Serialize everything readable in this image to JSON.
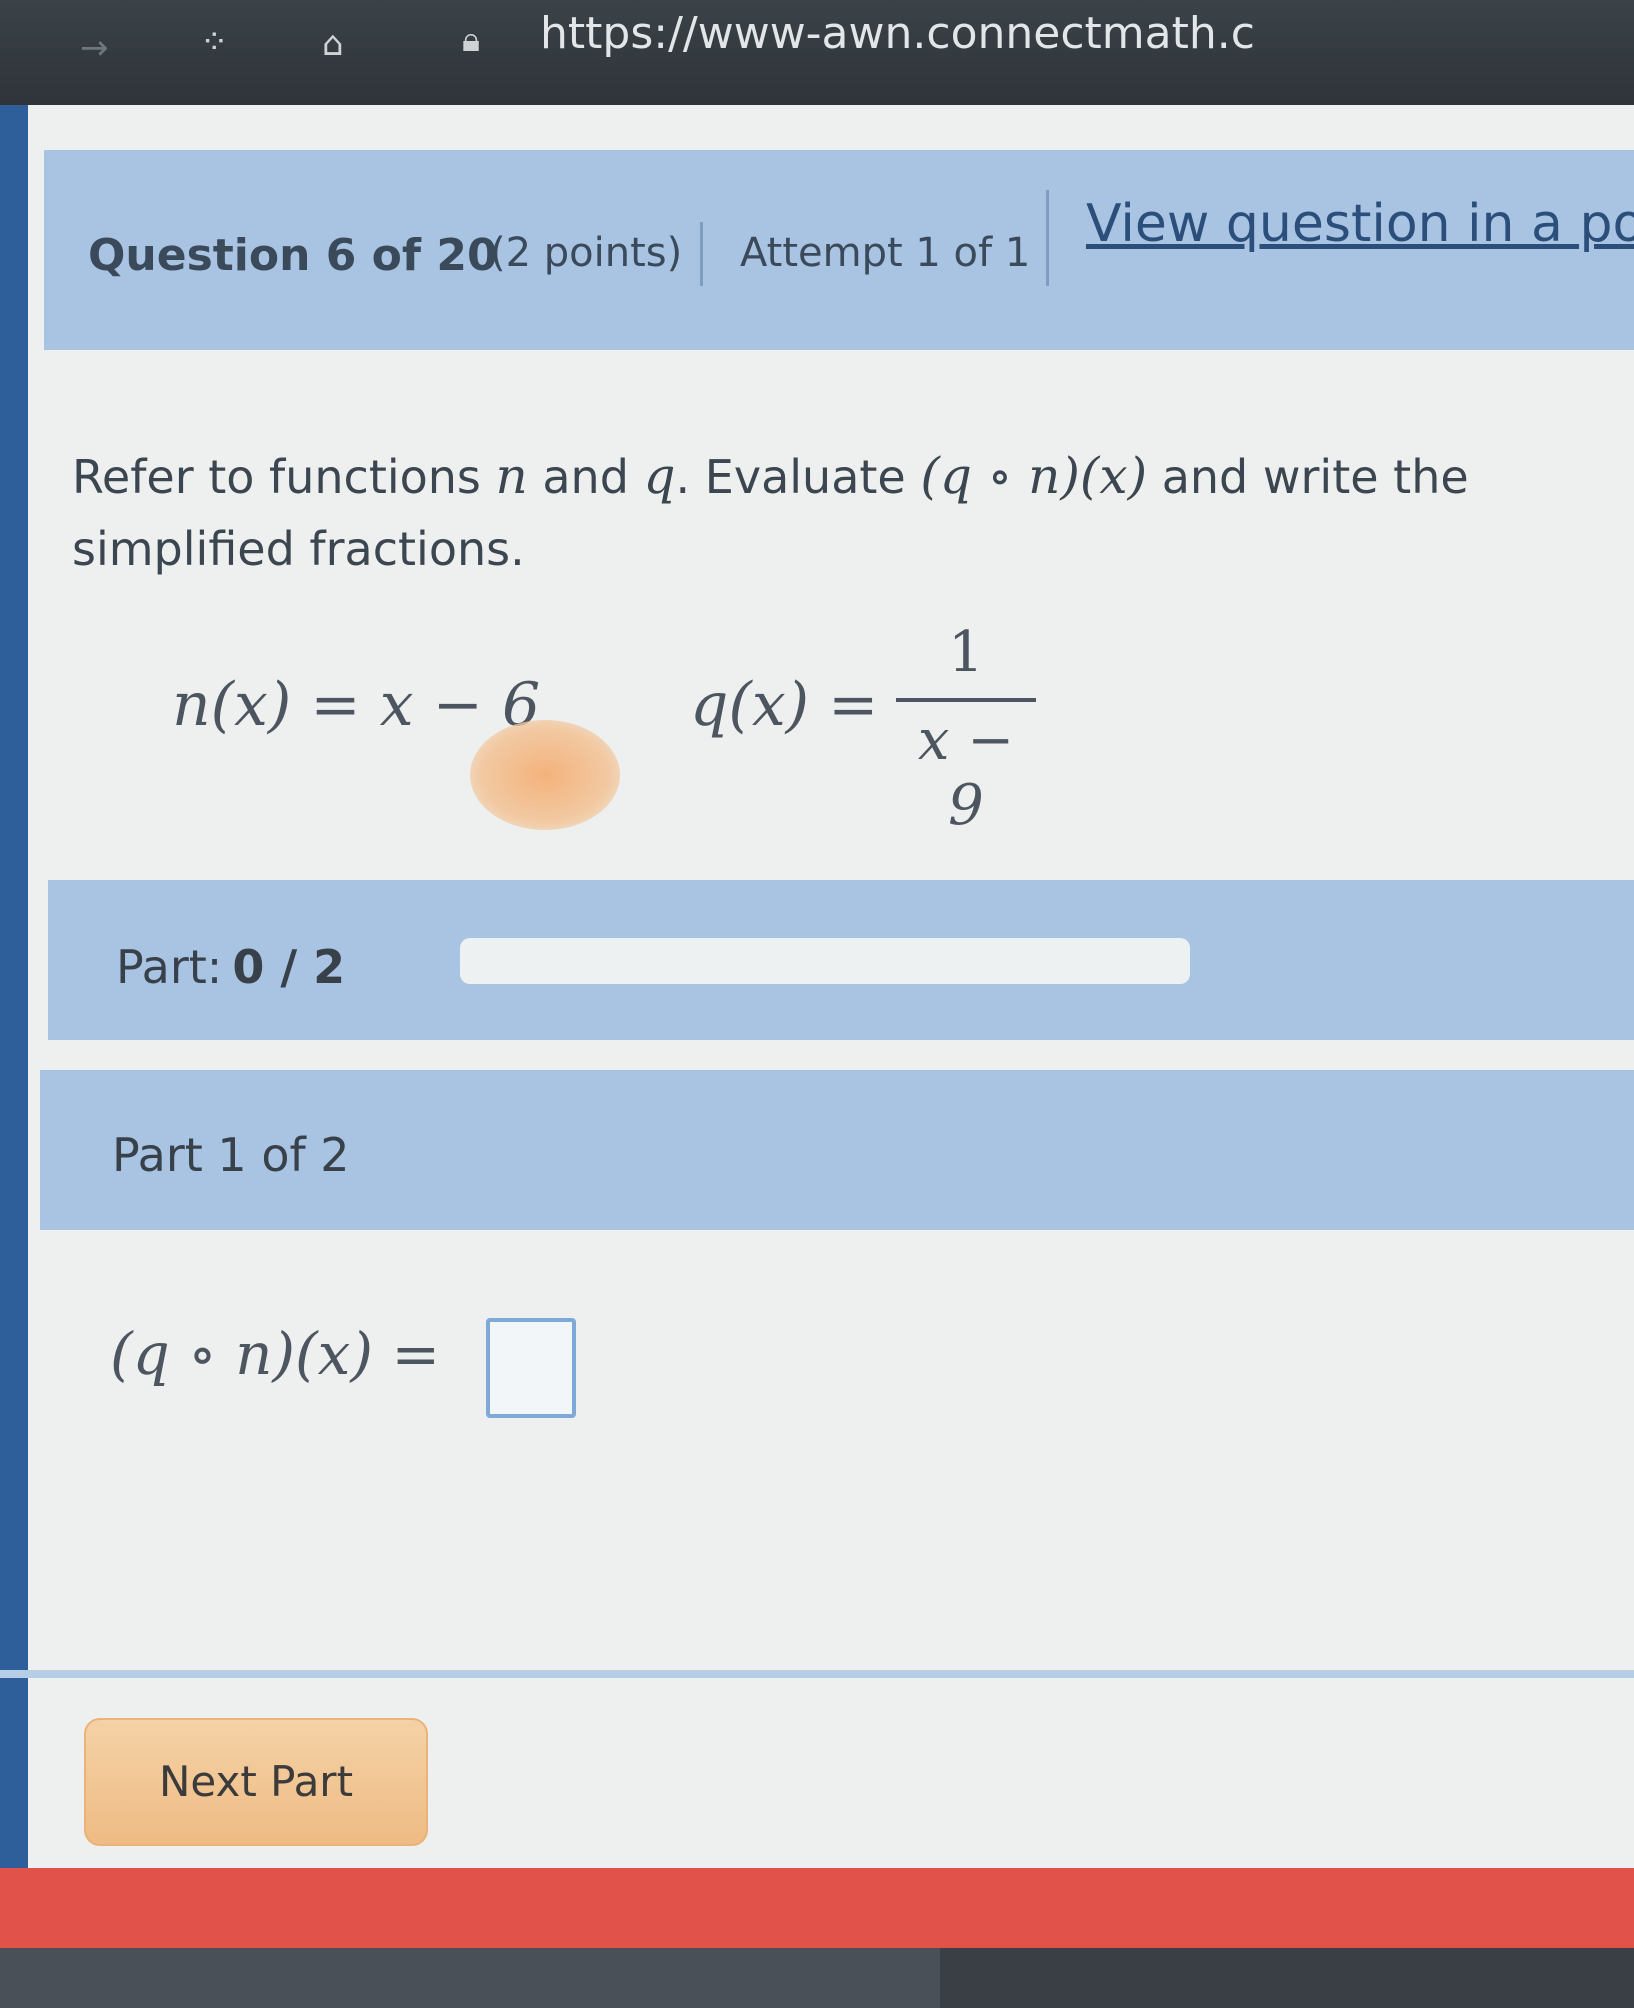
{
  "browser": {
    "url": "https://www-awn.connectmath.c"
  },
  "question_header": {
    "question_number": "Question 6 of 20",
    "points": "(2 points)",
    "attempt": "Attempt 1 of 1",
    "view_link": "View question in a po"
  },
  "prompt": {
    "text_start": "Refer to functions",
    "var_n": "n",
    "and1": "and",
    "var_q": "q",
    "evaluate": ". Evaluate",
    "composition": "(q ∘ n)(x)",
    "text_end": "and write the",
    "line2": "simplified fractions."
  },
  "functions": {
    "n_def": "n(x) = x − 6",
    "q_lhs": "q(x) =",
    "q_numerator": "1",
    "q_denominator": "x − 9"
  },
  "progress": {
    "label": "Part:",
    "value": "0 / 2",
    "fraction": 0
  },
  "part": {
    "title": "Part 1 of 2",
    "answer_lhs": "(q ∘ n)(x) ="
  },
  "buttons": {
    "next_part": "Next Part"
  },
  "colors": {
    "header_blue": "#a9c4e3",
    "button_orange": "#efbb84",
    "red_bar": "#e0524a"
  }
}
